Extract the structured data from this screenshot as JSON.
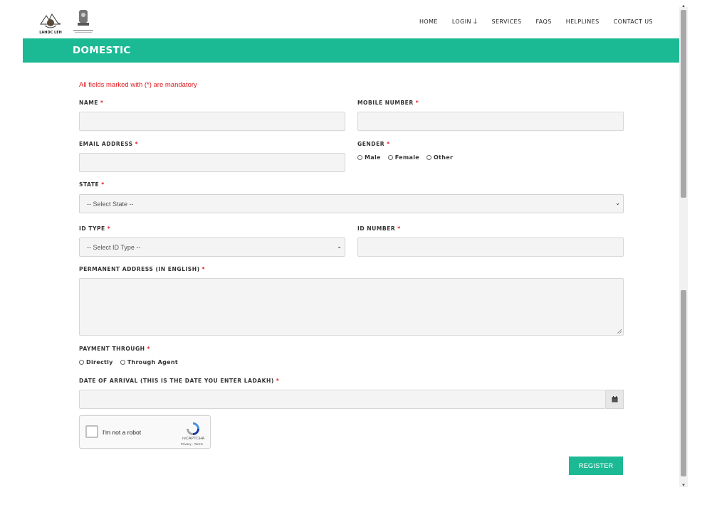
{
  "header": {
    "logos": [
      "ladakh-hill-council-logo",
      "national-emblem-logo"
    ],
    "logo_captions": [
      "LAHDC LEH",
      ""
    ],
    "nav": [
      {
        "label": "HOME"
      },
      {
        "label": "LOGIN"
      },
      {
        "label": "SERVICES"
      },
      {
        "label": "FAQS"
      },
      {
        "label": "HELPLINES"
      },
      {
        "label": "CONTACT US"
      }
    ]
  },
  "banner": {
    "title": "DOMESTIC",
    "color": "#1cb995"
  },
  "form": {
    "mandatory_note": "All fields marked with (*) are mandatory",
    "name_label": "NAME",
    "mobile_label": "MOBILE NUMBER",
    "email_label": "EMAIL ADDRESS",
    "gender_label": "GENDER",
    "gender_options": [
      "Male",
      "Female",
      "Other"
    ],
    "state_label": "STATE",
    "state_selected": "-- Select State --",
    "id_type_label": "ID TYPE",
    "id_type_selected": "-- Select ID Type --",
    "id_number_label": "ID NUMBER",
    "address_label": "PERMANENT ADDRESS (IN ENGLISH)",
    "payment_label": "PAYMENT THROUGH",
    "payment_options": [
      "Directly",
      "Through Agent"
    ],
    "arrival_label": "DATE OF ARRIVAL (THIS IS THE DATE YOU ENTER LADAKH)",
    "required_marker": "*",
    "captcha": {
      "text": "I'm not a robot",
      "brand": "reCAPTCHA",
      "links": "Privacy - Terms"
    },
    "register_label": "REGISTER"
  },
  "colors": {
    "accent": "#1cb995",
    "required": "#e0191e"
  }
}
